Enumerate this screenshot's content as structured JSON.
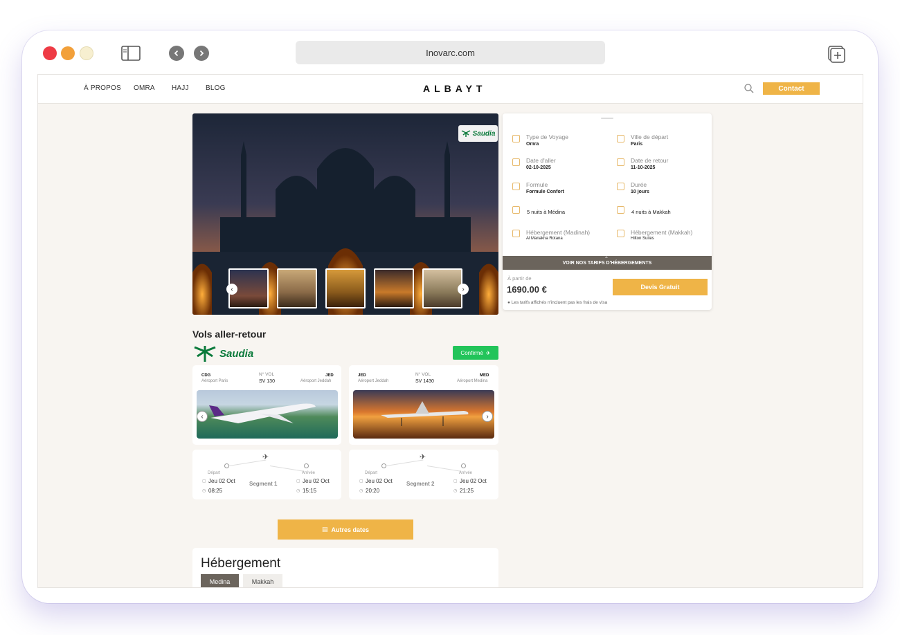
{
  "browser": {
    "url": "Inovarc.com"
  },
  "nav": {
    "links": [
      "À PROPOS",
      "OMRA",
      "HAJJ",
      "BLOG"
    ],
    "logo": "ALBAYT",
    "contact": "Contact"
  },
  "hero": {
    "badge": "Saudia"
  },
  "trip": {
    "type_label": "Type de Voyage",
    "type_value": "Omra",
    "city_label": "Ville de départ",
    "city_value": "Paris",
    "depart_label": "Date d'aller",
    "depart_value": "02-10-2025",
    "return_label": "Date de retour",
    "return_value": "11-10-2025",
    "formule_label": "Formule",
    "formule_value": "Formule Confort",
    "duree_label": "Durée",
    "duree_value": "10 jours",
    "nights_medina": "5 nuits à Médina",
    "nights_makkah": "4 nuits à Makkah",
    "heb_med_label": "Hébergement (Madinah)",
    "heb_med_value": "Al Manakha Rotana",
    "heb_mak_label": "Hébergement (Makkah)",
    "heb_mak_value": "Hilton Suites",
    "rates_bar": "VOIR NOS TARIFS D'HÉBERGEMENTS",
    "from_label": "À partir de",
    "price": "1690.00 €",
    "note": "Les tarifs affichés n'incluent pas les frais de visa",
    "devis": "Devis Gratuit"
  },
  "flights": {
    "title": "Vols aller-retour",
    "airline": "Saudia",
    "status": "Confirmé",
    "segments": [
      {
        "from_code": "CDG",
        "from_name": "Aéroport Paris",
        "vol_label": "N° VOL",
        "vol": "SV 130",
        "to_code": "JED",
        "to_name": "Aéroport Jeddah",
        "dep_label": "Départ",
        "arr_label": "Arrivée",
        "dep_date": "Jeu 02 Oct",
        "dep_time": "08:25",
        "arr_date": "Jeu 02 Oct",
        "arr_time": "15:15",
        "name": "Segment 1"
      },
      {
        "from_code": "JED",
        "from_name": "Aéroport Jeddah",
        "vol_label": "N° VOL",
        "vol": "SV 1430",
        "to_code": "MED",
        "to_name": "Aéroport Medina",
        "dep_label": "Départ",
        "arr_label": "Arrivée",
        "dep_date": "Jeu 02 Oct",
        "dep_time": "20:20",
        "arr_date": "Jeu 02 Oct",
        "arr_time": "21:25",
        "name": "Segment 2"
      }
    ],
    "other_dates": "Autres dates"
  },
  "hebergement": {
    "title": "Hébergement",
    "tabs": [
      "Medina",
      "Makkah"
    ]
  },
  "colors": {
    "accent": "#efb447",
    "green": "#22c45a",
    "dark": "#6b645c"
  }
}
